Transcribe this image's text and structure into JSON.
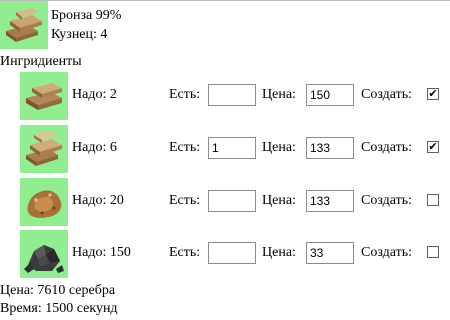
{
  "product": {
    "name": "Бронза 99%",
    "smith": "Кузнец: 4",
    "icon": "bronze-ingots-icon"
  },
  "ingredients_label": "Ингридиенты",
  "field_labels": {
    "have": "Есть:",
    "price": "Цена:",
    "create": "Создать:"
  },
  "ingredients": [
    {
      "need": "Надо: 2",
      "have": "",
      "price": "150",
      "create": true,
      "icon": "copper-ingots-icon"
    },
    {
      "need": "Надо: 6",
      "have": "1",
      "price": "133",
      "create": true,
      "icon": "tin-bars-icon"
    },
    {
      "need": "Надо: 20",
      "have": "",
      "price": "133",
      "create": false,
      "icon": "copper-ore-icon"
    },
    {
      "need": "Надо: 150",
      "have": "",
      "price": "33",
      "create": false,
      "icon": "coal-icon"
    }
  ],
  "footer": {
    "price": "Цена: 7610 серебра",
    "time": "Время: 1500 секунд"
  },
  "colors": {
    "tile_bg": "#90ee90",
    "ingot": "#c8a06a",
    "ore": "#b07a3c",
    "coal": "#3a3a3a"
  }
}
